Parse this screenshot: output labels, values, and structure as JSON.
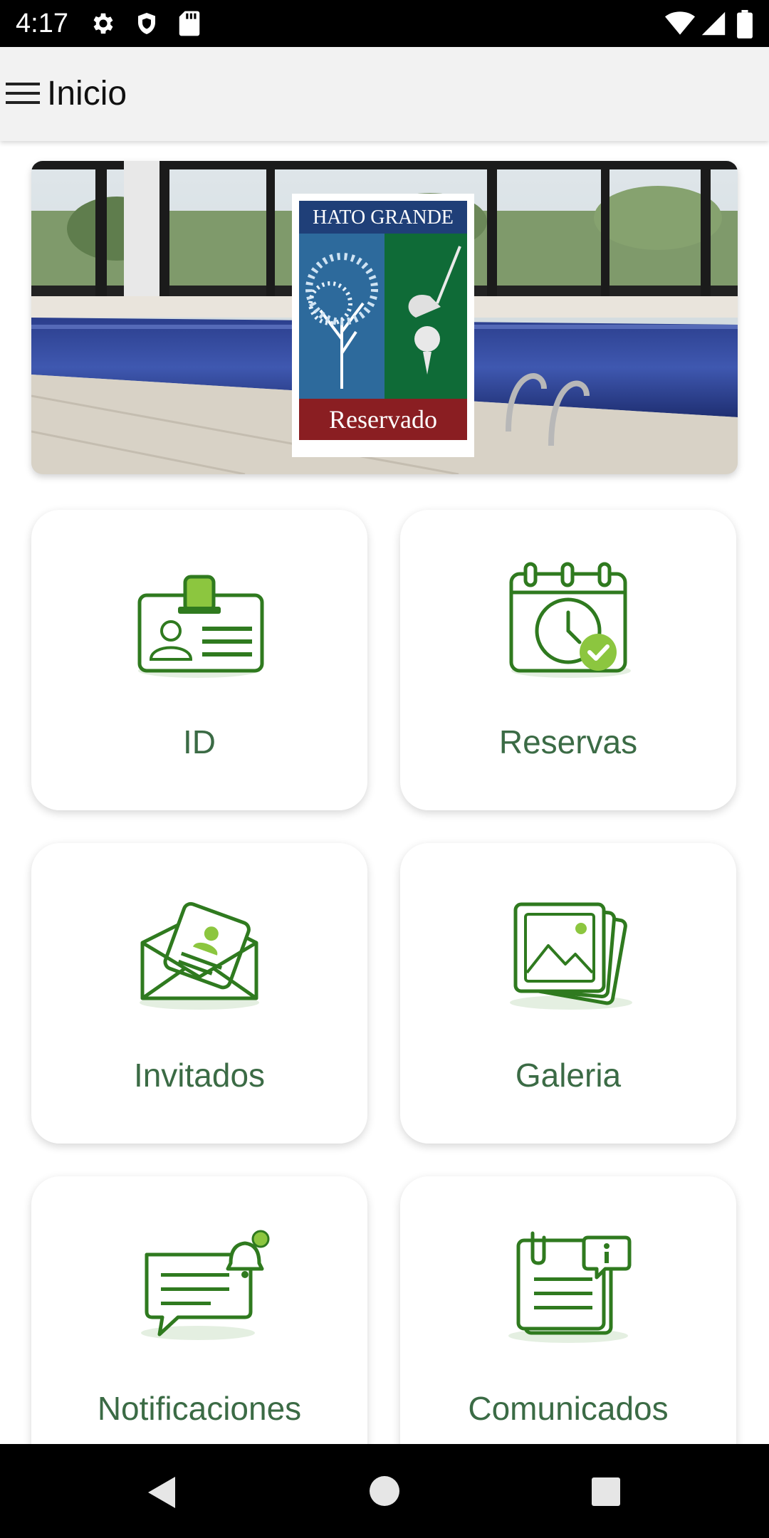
{
  "status_bar": {
    "time": "4:17",
    "icons": [
      "settings-icon",
      "shield-icon",
      "sd-card-icon",
      "wifi-icon",
      "signal-icon",
      "battery-icon"
    ]
  },
  "app_bar": {
    "title": "Inicio",
    "menu_icon": "hamburger-menu-icon"
  },
  "banner": {
    "logo_title": "HATO GRANDE",
    "logo_subtitle": "Reservado"
  },
  "menu": {
    "items": [
      {
        "label": "ID",
        "icon": "id-badge-icon"
      },
      {
        "label": "Reservas",
        "icon": "calendar-clock-icon"
      },
      {
        "label": "Invitados",
        "icon": "invitation-envelope-icon"
      },
      {
        "label": "Galeria",
        "icon": "gallery-photos-icon"
      },
      {
        "label": "Notificaciones",
        "icon": "chat-bell-icon"
      },
      {
        "label": "Comunicados",
        "icon": "clipboard-info-icon"
      }
    ]
  },
  "nav_bar": {
    "buttons": [
      "back-icon",
      "home-icon",
      "recents-icon"
    ]
  },
  "colors": {
    "accent_green": "#2f7a1f",
    "light_green": "#8cc63f",
    "label_green": "#3b6b45"
  }
}
